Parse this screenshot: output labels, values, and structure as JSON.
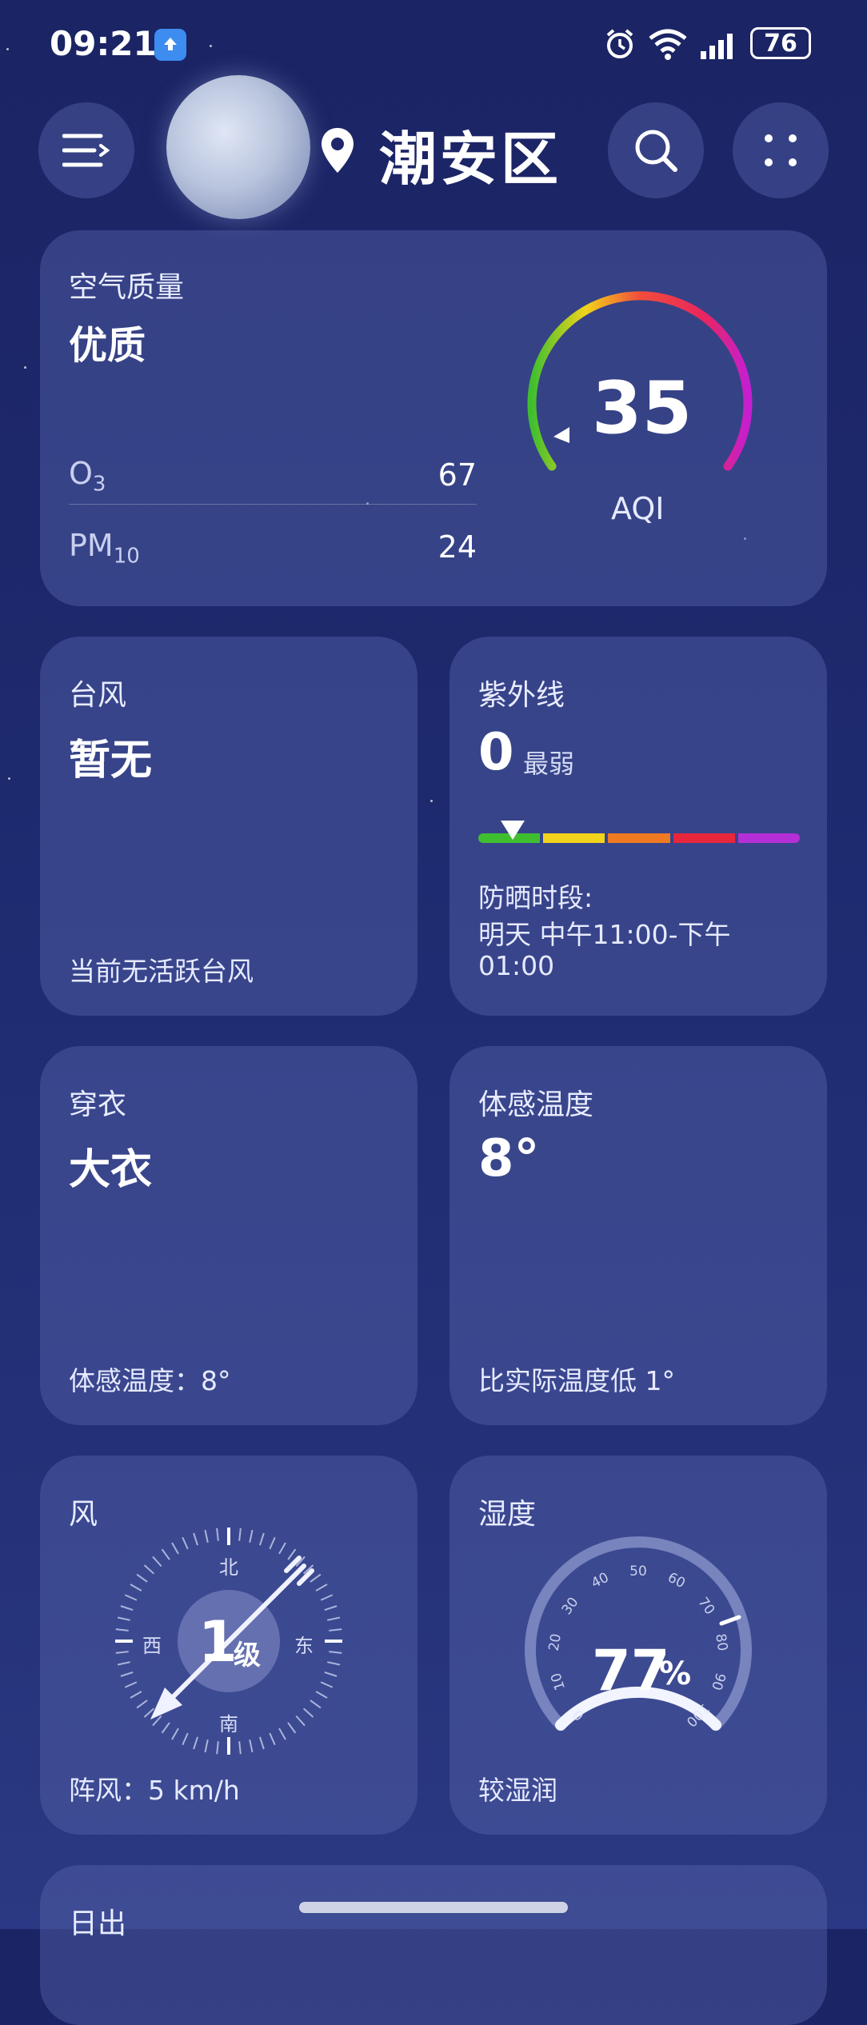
{
  "status_bar": {
    "time": "09:21",
    "battery": "76",
    "icons": [
      "upload-arrow-icon",
      "alarm-icon",
      "wifi-icon",
      "signal-icon",
      "battery-icon"
    ]
  },
  "header": {
    "location": "潮安区",
    "icons": [
      "menu-icon",
      "moon-icon",
      "location-pin-icon",
      "search-icon",
      "more-dots-icon"
    ]
  },
  "air_quality": {
    "title": "空气质量",
    "level": "优质",
    "aqi_value": "35",
    "aqi_label": "AQI",
    "aqi_numeric": 35,
    "pollutants": [
      {
        "name": "O",
        "sub": "3",
        "value": "67"
      },
      {
        "name": "PM",
        "sub": "10",
        "value": "24"
      }
    ]
  },
  "typhoon": {
    "title": "台风",
    "value": "暂无",
    "note": "当前无活跃台风"
  },
  "uv": {
    "title": "紫外线",
    "value": "0",
    "level": "最弱",
    "scale_colors": [
      "#3fbf2f",
      "#f2d31b",
      "#f07a22",
      "#e8263c",
      "#b52fd6"
    ],
    "indicator_fraction": 0.1,
    "sun_label": "防晒时段:",
    "sun_time": "明天 中午11:00-下午",
    "sun_time2": "01:00"
  },
  "clothing": {
    "title": "穿衣",
    "value": "大衣",
    "note": "体感温度：8°"
  },
  "feels_like": {
    "title": "体感温度",
    "value": "8°",
    "note": "比实际温度低 1°"
  },
  "wind": {
    "title": "风",
    "level_num": "1",
    "level_unit": "级",
    "directions": {
      "n": "北",
      "s": "南",
      "e": "东",
      "w": "西"
    },
    "gust": "阵风：5 km/h"
  },
  "humidity": {
    "title": "湿度",
    "value": "77",
    "unit": "%",
    "numeric": 77,
    "ticks": [
      "0",
      "10",
      "20",
      "30",
      "40",
      "50",
      "60",
      "70",
      "80",
      "90",
      "100"
    ],
    "note": "较湿润"
  },
  "sunrise": {
    "title": "日出"
  },
  "colors": {
    "accent_ring_start": "#3fbf2f",
    "accent_ring_mid": "#f24d3a",
    "accent_ring_end": "#d11fc0"
  }
}
